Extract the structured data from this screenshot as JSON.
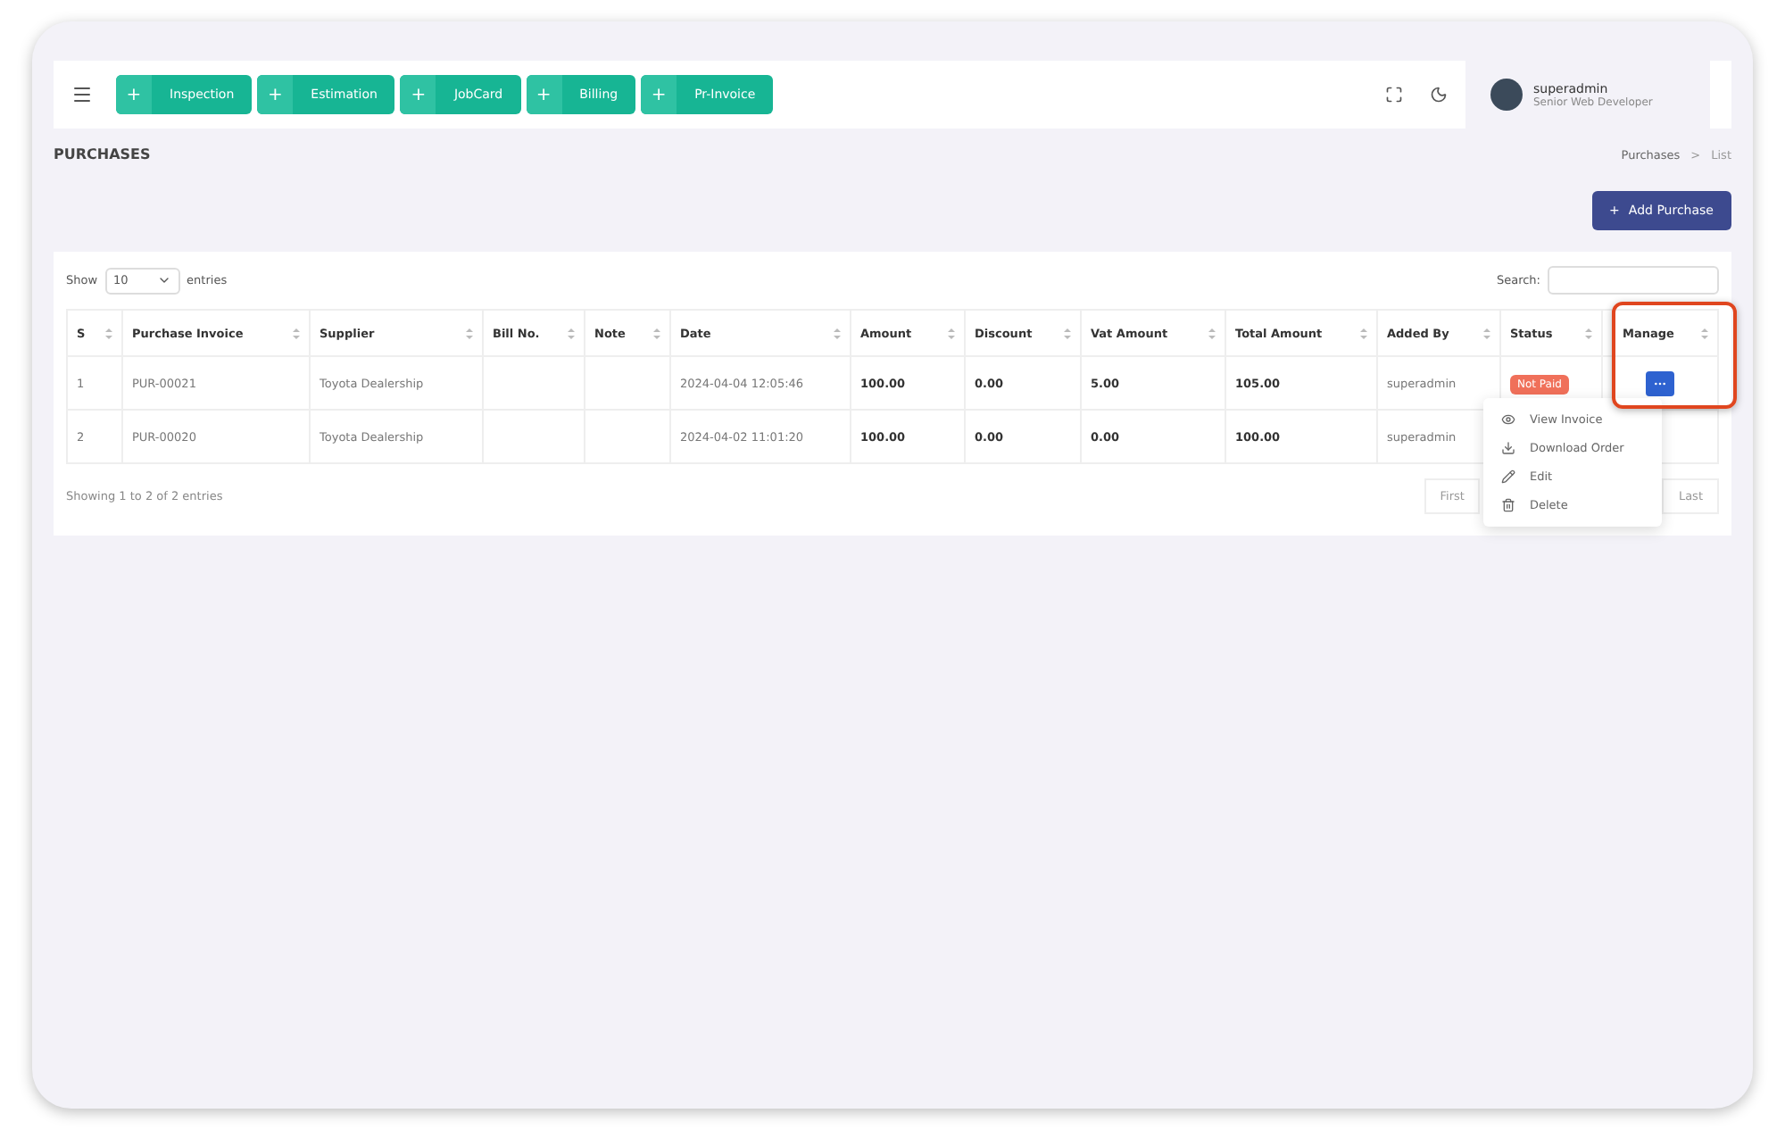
{
  "toolbar": {
    "quick_buttons": [
      {
        "icon": "+",
        "label": "Inspection"
      },
      {
        "icon": "+",
        "label": "Estimation"
      },
      {
        "icon": "+",
        "label": "JobCard"
      },
      {
        "icon": "+",
        "label": "Billing"
      },
      {
        "icon": "+",
        "label": "Pr-Invoice"
      }
    ]
  },
  "user": {
    "name": "superadmin",
    "role": "Senior Web Developer"
  },
  "page": {
    "title": "PURCHASES",
    "breadcrumb": [
      {
        "label": "Purchases",
        "selected": false
      },
      {
        "label": "List",
        "selected": true
      }
    ],
    "breadcrumb_separator": ">",
    "add_button": {
      "icon": "+",
      "label": "Add Purchase"
    }
  },
  "table": {
    "show_label": "Show",
    "page_size": "10",
    "entries_label": "entries",
    "search_label": "Search:",
    "columns": [
      "S",
      "Purchase Invoice",
      "Supplier",
      "Bill No.",
      "Note",
      "Date",
      "Amount",
      "Discount",
      "Vat Amount",
      "Total Amount",
      "Added By",
      "Status",
      "Manage"
    ],
    "rows": [
      {
        "cells": [
          "1",
          "PUR-00021",
          "Toyota Dealership",
          "",
          "",
          "2024-04-04 12:05:46",
          "100.00",
          "0.00",
          "5.00",
          "105.00",
          "superadmin"
        ],
        "status": "Not Paid",
        "manage_visible": true
      },
      {
        "cells": [
          "2",
          "PUR-00020",
          "Toyota Dealership",
          "",
          "",
          "2024-04-02 11:01:20",
          "100.00",
          "0.00",
          "0.00",
          "100.00",
          "superadmin"
        ],
        "manage_visible": false
      }
    ],
    "info": "Showing 1 to 2 of 2 entries",
    "pagination": [
      {
        "label": "First"
      },
      {
        "label": "Last"
      }
    ]
  },
  "dropdown": {
    "items": [
      {
        "kind": "view",
        "label": "View Invoice"
      },
      {
        "kind": "download",
        "label": "Download Order"
      },
      {
        "kind": "edit",
        "label": "Edit"
      },
      {
        "kind": "delete",
        "label": "Delete"
      }
    ]
  },
  "highlight": {
    "on": true
  }
}
